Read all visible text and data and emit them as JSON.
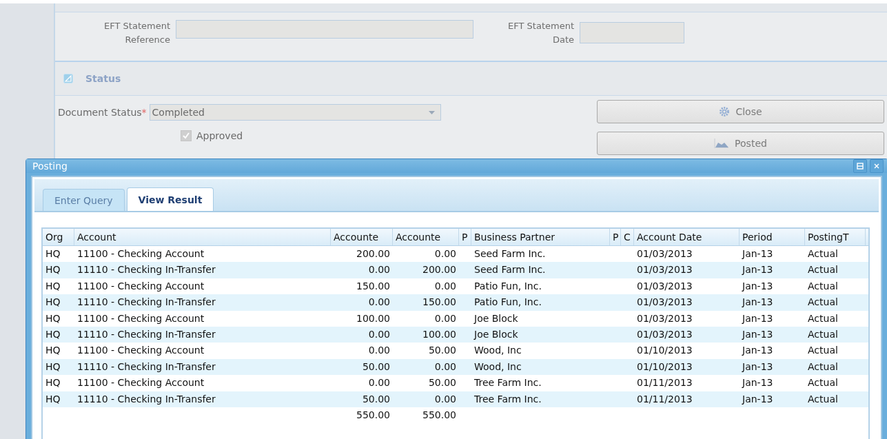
{
  "form": {
    "eft_reference": {
      "label": "EFT Statement Reference"
    },
    "eft_date": {
      "label": "EFT Statement Date"
    },
    "status_section": {
      "title": "Status",
      "expanded": true
    },
    "document_status": {
      "label": "Document Status",
      "required_mark": "*",
      "value": "Completed"
    },
    "approved": {
      "label": "Approved",
      "checked": true
    },
    "buttons": [
      {
        "label": "Close",
        "kind": "gear"
      },
      {
        "label": "Posted",
        "kind": "chart"
      }
    ]
  },
  "posting_window": {
    "title": "Posting",
    "tabs": [
      {
        "label": "Enter Query",
        "selected": false
      },
      {
        "label": "View Result",
        "selected": true
      }
    ],
    "table": {
      "columns": [
        "Org",
        "Account",
        "Accounte",
        "Accounte",
        "P",
        "Business Partner",
        "P",
        "C",
        "Account Date",
        "Period",
        "PostingT"
      ],
      "rows": [
        {
          "org": "HQ",
          "account": "11100 - Checking Account",
          "debit": "200.00",
          "credit": "0.00",
          "partner": "Seed Farm Inc.",
          "date": "01/03/2013",
          "period": "Jan-13",
          "posting_type": "Actual"
        },
        {
          "org": "HQ",
          "account": "11110 - Checking In-Transfer",
          "debit": "0.00",
          "credit": "200.00",
          "partner": "Seed Farm Inc.",
          "date": "01/03/2013",
          "period": "Jan-13",
          "posting_type": "Actual"
        },
        {
          "org": "HQ",
          "account": "11100 - Checking Account",
          "debit": "150.00",
          "credit": "0.00",
          "partner": "Patio Fun, Inc.",
          "date": "01/03/2013",
          "period": "Jan-13",
          "posting_type": "Actual"
        },
        {
          "org": "HQ",
          "account": "11110 - Checking In-Transfer",
          "debit": "0.00",
          "credit": "150.00",
          "partner": "Patio Fun, Inc.",
          "date": "01/03/2013",
          "period": "Jan-13",
          "posting_type": "Actual"
        },
        {
          "org": "HQ",
          "account": "11100 - Checking Account",
          "debit": "100.00",
          "credit": "0.00",
          "partner": "Joe Block",
          "date": "01/03/2013",
          "period": "Jan-13",
          "posting_type": "Actual"
        },
        {
          "org": "HQ",
          "account": "11110 - Checking In-Transfer",
          "debit": "0.00",
          "credit": "100.00",
          "partner": "Joe Block",
          "date": "01/03/2013",
          "period": "Jan-13",
          "posting_type": "Actual"
        },
        {
          "org": "HQ",
          "account": "11100 - Checking Account",
          "debit": "0.00",
          "credit": "50.00",
          "partner": "Wood, Inc",
          "date": "01/10/2013",
          "period": "Jan-13",
          "posting_type": "Actual"
        },
        {
          "org": "HQ",
          "account": "11110 - Checking In-Transfer",
          "debit": "50.00",
          "credit": "0.00",
          "partner": "Wood, Inc",
          "date": "01/10/2013",
          "period": "Jan-13",
          "posting_type": "Actual"
        },
        {
          "org": "HQ",
          "account": "11100 - Checking Account",
          "debit": "0.00",
          "credit": "50.00",
          "partner": "Tree Farm Inc.",
          "date": "01/11/2013",
          "period": "Jan-13",
          "posting_type": "Actual"
        },
        {
          "org": "HQ",
          "account": "11110 - Checking In-Transfer",
          "debit": "50.00",
          "credit": "0.00",
          "partner": "Tree Farm Inc.",
          "date": "01/11/2013",
          "period": "Jan-13",
          "posting_type": "Actual"
        }
      ],
      "totals": {
        "debit": "550.00",
        "credit": "550.00"
      }
    }
  }
}
